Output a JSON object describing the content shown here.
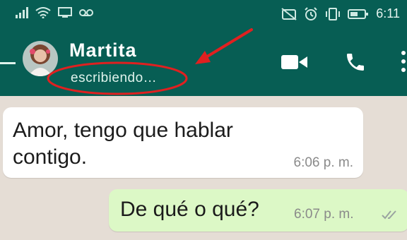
{
  "status_bar": {
    "time": "6:11",
    "icons": [
      "signal-icon",
      "wifi-icon",
      "screen-icon",
      "voicemail-icon",
      "mute-icon",
      "alarm-icon",
      "vibrate-icon",
      "battery-icon"
    ]
  },
  "header": {
    "contact_name": "Martita",
    "status": "escribiendo…",
    "icons": [
      "back-arrow-icon",
      "video-call-icon",
      "phone-icon",
      "more-icon"
    ],
    "color": "#075e54"
  },
  "messages": [
    {
      "direction": "incoming",
      "text": "Amor, tengo que hablar contigo.",
      "time": "6:06 p. m."
    },
    {
      "direction": "outgoing",
      "text": "De qué o qué?",
      "time": "6:07 p. m.",
      "status_icon": "double-check-icon"
    }
  ],
  "colors": {
    "chat_background": "#e5ddd5",
    "incoming_bubble": "#ffffff",
    "outgoing_bubble": "#dcf8c6",
    "annotation": "#e02020"
  }
}
